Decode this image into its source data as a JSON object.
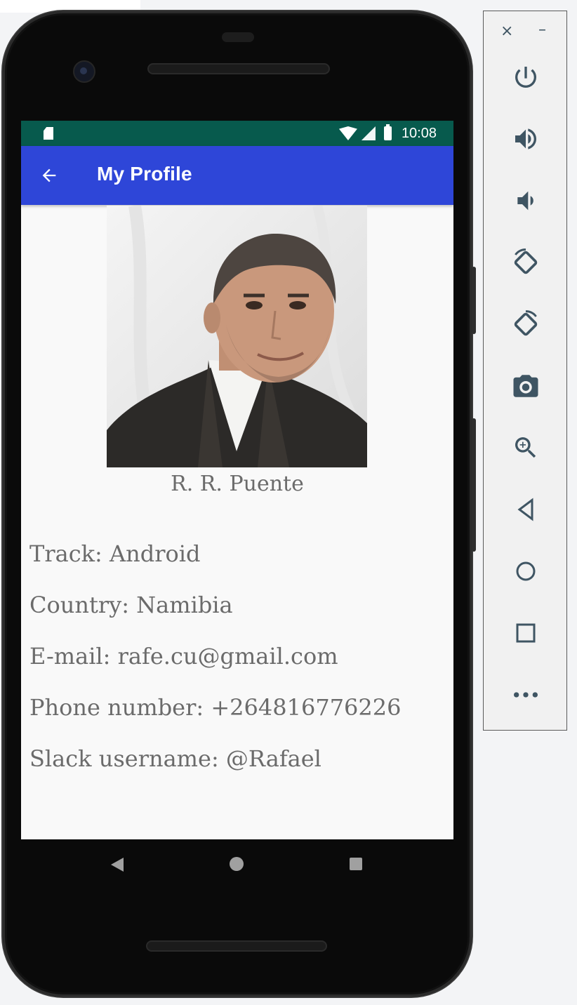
{
  "status_bar": {
    "time": "10:08"
  },
  "app_bar": {
    "title": "My Profile"
  },
  "profile": {
    "name": "R. R. Puente",
    "track": "Track: Android",
    "country": "Country: Namibia",
    "email": "E-mail: rafe.cu@gmail.com",
    "phone": "Phone number: +264816776226",
    "slack": "Slack username: @Rafael"
  },
  "emulator_panel": {
    "close": "×",
    "minimize": "–",
    "buttons": [
      "power-icon",
      "volume-up-icon",
      "volume-down-icon",
      "rotate-left-icon",
      "rotate-right-icon",
      "camera-icon",
      "zoom-icon",
      "back-icon",
      "home-icon",
      "overview-icon",
      "more-icon"
    ]
  },
  "colors": {
    "status_bar": "#075a4d",
    "app_bar": "#2e46d8",
    "text_gray": "#6b6b6b",
    "icon_slate": "#3f5563"
  }
}
